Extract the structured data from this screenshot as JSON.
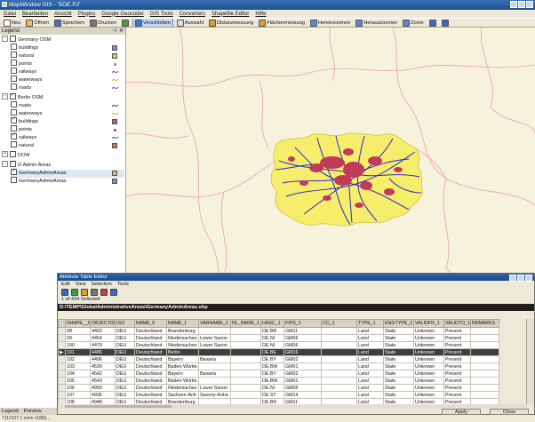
{
  "app": {
    "title": "MapWindow GIS - 'SOE.PJ'",
    "window_buttons": [
      "minimize-icon",
      "maximize-icon",
      "close-icon"
    ]
  },
  "menu": [
    "Datei",
    "Bearbeiten",
    "Ansicht",
    "Plugins",
    "Google Geocoder",
    "GIS Tools",
    "Converters",
    "Shapefile Editor",
    "Hilfe"
  ],
  "toolbar": [
    {
      "label": "Neu",
      "icon": "new-file-icon",
      "color": "#ffffff"
    },
    {
      "label": "Öffnen",
      "icon": "open-folder-icon",
      "color": "#e8c25a"
    },
    {
      "label": "Speichern",
      "icon": "save-icon",
      "color": "#4a6fb5"
    },
    {
      "label": "Drucken",
      "icon": "print-icon",
      "color": "#777777"
    },
    {
      "label": "",
      "icon": "layer-add-icon",
      "color": "#4a9a3a"
    },
    {
      "label": "Verschieben",
      "icon": "pan-icon",
      "color": "#3a7ac8",
      "active": true
    },
    {
      "label": "Auswahl",
      "icon": "select-icon",
      "color": "#dddddd"
    },
    {
      "label": "Distanzmessung",
      "icon": "measure-distance-icon",
      "color": "#d9a030"
    },
    {
      "label": "Flächenmessung",
      "icon": "measure-area-icon",
      "color": "#d9a030"
    },
    {
      "label": "Hereinzoomen",
      "icon": "zoom-in-icon",
      "color": "#5a8ad0"
    },
    {
      "label": "Herauszoomen",
      "icon": "zoom-out-icon",
      "color": "#5a8ad0"
    },
    {
      "label": "Zoom",
      "icon": "zoom-icon",
      "color": "#5a8ad0"
    },
    {
      "label": "",
      "icon": "info-icon",
      "color": "#3a6ac0"
    },
    {
      "label": "",
      "icon": "table-icon",
      "color": "#3a6ac0"
    }
  ],
  "legend": {
    "title": "Legend",
    "groups": [
      {
        "name": "Germany OSM",
        "checked": false,
        "layers": [
          {
            "name": "buildings",
            "checked": false,
            "symbol": "square",
            "color": "#c86ab0"
          },
          {
            "name": "natural",
            "checked": false,
            "symbol": "square",
            "color": "#b8d860"
          },
          {
            "name": "points",
            "checked": false,
            "symbol": "dot",
            "color": "#d06a6a"
          },
          {
            "name": "railways",
            "checked": false,
            "symbol": "line",
            "color": "#7a3a8a"
          },
          {
            "name": "waterways",
            "checked": false,
            "symbol": "line",
            "color": "#d8b040"
          },
          {
            "name": "roads",
            "checked": false,
            "symbol": "line",
            "color": "#6a4a8a"
          }
        ]
      },
      {
        "name": "Berlin OSM",
        "checked": true,
        "layers": [
          {
            "name": "roads",
            "checked": false,
            "symbol": "line",
            "color": "#333333"
          },
          {
            "name": "waterways",
            "checked": false,
            "symbol": "line",
            "color": "#d8b040"
          },
          {
            "name": "buildings",
            "checked": true,
            "symbol": "square",
            "color": "#e04a6a"
          },
          {
            "name": "points",
            "checked": false,
            "symbol": "dot",
            "color": "#d03030"
          },
          {
            "name": "railways",
            "checked": true,
            "symbol": "line",
            "color": "#3a3ab0"
          },
          {
            "name": "natural",
            "checked": false,
            "symbol": "square",
            "color": "#e07030"
          }
        ]
      },
      {
        "name": "DOW",
        "checked": false,
        "layers": []
      },
      {
        "name": "G Admin Areas",
        "checked": true,
        "layers": [
          {
            "name": "GermanyAdminAreas",
            "checked": true,
            "symbol": "square",
            "color": "#f0b080",
            "selected": true
          },
          {
            "name": "GermanyAdminAreas",
            "checked": false,
            "symbol": "square",
            "color": "#7090c0"
          }
        ]
      }
    ],
    "footer_tabs": [
      "Legend",
      "Preview"
    ]
  },
  "statusbar": "7112107.1 xmm 11882...",
  "attribute_table": {
    "title": "Attribute Table Editor",
    "menu": [
      "Edit",
      "View",
      "Selection",
      "Tools"
    ],
    "tools": [
      "find-icon",
      "grid-icon",
      "refresh-icon",
      "table-icon",
      "query-icon",
      "undo-icon"
    ],
    "record_info": "1 of 434 Selected",
    "path": "D:\\TEMP\\GlobalAdministrativeAreas\\GermanyAdminAreas.shp",
    "columns": [
      "",
      "SHAPE__ID",
      "OBJECTID",
      "ISO",
      "NAME_0",
      "NAME_1",
      "VARNAME_1",
      "NL_NAME_1",
      "HASC_1",
      "FIPS_1",
      "CC_1",
      "TYPE_1",
      "ENGTYPE_1",
      "VALIDFR_1",
      "VALIDTO_1",
      "REMARKS"
    ],
    "rows": [
      {
        "marker": "",
        "cells": [
          "98",
          "4402",
          "DEU",
          "Deutschland",
          "Brandenburg",
          "",
          "",
          "DE.BR",
          "GM11",
          "",
          "Land",
          "State",
          "Unknown",
          "Present",
          ""
        ]
      },
      {
        "marker": "",
        "cells": [
          "99",
          "4454",
          "DEU",
          "Deutschland",
          "Niedersachse",
          "Lower Saxon",
          "",
          "DE.NI",
          "GM06",
          "",
          "Land",
          "State",
          "Unknown",
          "Present",
          ""
        ]
      },
      {
        "marker": "",
        "cells": [
          "100",
          "4479",
          "DEU",
          "Deutschland",
          "Niedersachse",
          "Lower Saxon",
          "",
          "DE.NI",
          "GM06",
          "",
          "Land",
          "State",
          "Unknown",
          "Present",
          ""
        ]
      },
      {
        "marker": "▶",
        "selected": true,
        "cells": [
          "101",
          "4486",
          "DEU",
          "Deutschland",
          "Berlin",
          "",
          "",
          "DE.BE",
          "GM16",
          "",
          "Land",
          "State",
          "Unknown",
          "Present",
          ""
        ]
      },
      {
        "marker": "",
        "cells": [
          "102",
          "4496",
          "DEU",
          "Deutschland",
          "Bayern",
          "Bavaria",
          "",
          "DE.BY",
          "GM02",
          "",
          "Land",
          "State",
          "Unknown",
          "Present",
          ""
        ]
      },
      {
        "marker": "",
        "cells": [
          "103",
          "4539",
          "DEU",
          "Deutschland",
          "Baden-Württe",
          "",
          "",
          "DE.BW",
          "GM01",
          "",
          "Land",
          "State",
          "Unknown",
          "Present",
          ""
        ]
      },
      {
        "marker": "",
        "cells": [
          "104",
          "4542",
          "DEU",
          "Deutschland",
          "Bayern",
          "Bavaria",
          "",
          "DE.BY",
          "GM02",
          "",
          "Land",
          "State",
          "Unknown",
          "Present",
          ""
        ]
      },
      {
        "marker": "",
        "cells": [
          "105",
          "4543",
          "DEU",
          "Deutschland",
          "Baden-Württe",
          "",
          "",
          "DE.BW",
          "GM01",
          "",
          "Land",
          "State",
          "Unknown",
          "Present",
          ""
        ]
      },
      {
        "marker": "",
        "cells": [
          "106",
          "4900",
          "DEU",
          "Deutschland",
          "Niedersachse",
          "Lower Saxon",
          "",
          "DE.NI",
          "GM06",
          "",
          "Land",
          "State",
          "Unknown",
          "Present",
          ""
        ]
      },
      {
        "marker": "",
        "cells": [
          "107",
          "4936",
          "DEU",
          "Deutschland",
          "Sachsen-Anh",
          "Saxony-Anha",
          "",
          "DE.ST",
          "GM14",
          "",
          "Land",
          "State",
          "Unknown",
          "Present",
          ""
        ]
      },
      {
        "marker": "",
        "cells": [
          "108",
          "4948",
          "DEU",
          "Deutschland",
          "Brandenburg",
          "",
          "",
          "DE.BR",
          "GM11",
          "",
          "Land",
          "State",
          "Unknown",
          "Present",
          ""
        ]
      }
    ],
    "buttons": {
      "apply": "Apply",
      "close": "Close"
    }
  },
  "map": {
    "background": "#f6f2dc",
    "border_color": "#e8a0a8",
    "berlin_fill": "#f6ee6a",
    "road_color": "#2a2ad0",
    "building_color": "#c03a5a"
  }
}
